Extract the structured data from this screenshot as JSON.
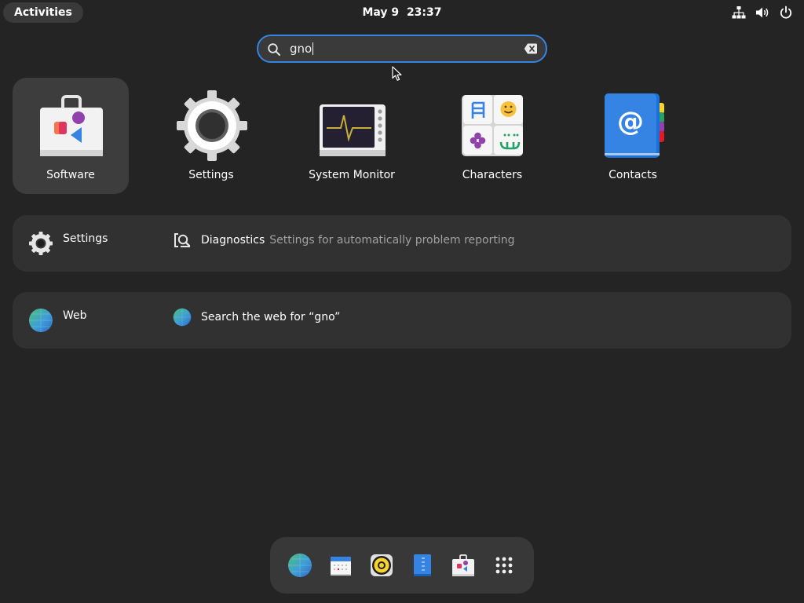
{
  "topbar": {
    "activities_label": "Activities",
    "date": "May 9",
    "time": "23:37",
    "tray_icons": [
      "network-icon",
      "volume-icon",
      "power-icon"
    ]
  },
  "search": {
    "query": "gno",
    "search_icon": "search-icon",
    "clear_icon": "clear-text-icon",
    "accent_color": "#3584e4"
  },
  "apps": [
    {
      "name": "Software",
      "icon": "software-store-icon",
      "selected": true
    },
    {
      "name": "Settings",
      "icon": "settings-gear-icon",
      "selected": false
    },
    {
      "name": "System Monitor",
      "icon": "system-monitor-icon",
      "selected": false
    },
    {
      "name": "Characters",
      "icon": "characters-icon",
      "selected": false
    },
    {
      "name": "Contacts",
      "icon": "contacts-icon",
      "selected": false
    }
  ],
  "providers": [
    {
      "name": "Settings",
      "icon": "settings-gear-icon",
      "result": {
        "icon": "diagnostics-icon",
        "title": "Diagnostics",
        "description": "Settings for automatically problem reporting"
      }
    },
    {
      "name": "Web",
      "icon": "web-globe-icon",
      "result": {
        "icon": "web-globe-icon",
        "title": "Search the web for “gno”"
      }
    }
  ],
  "dash": {
    "items": [
      {
        "name": "Web",
        "icon": "web-globe-icon"
      },
      {
        "name": "Calendar",
        "icon": "calendar-icon"
      },
      {
        "name": "Rhythmbox",
        "icon": "music-player-icon"
      },
      {
        "name": "Text Editor",
        "icon": "text-editor-icon"
      },
      {
        "name": "Software",
        "icon": "software-store-icon"
      },
      {
        "name": "Show Applications",
        "icon": "app-grid-icon"
      }
    ]
  },
  "colors": {
    "background": "#242424",
    "panel": "#313131",
    "selection": "#3d3d3d",
    "accent": "#3584e4"
  }
}
